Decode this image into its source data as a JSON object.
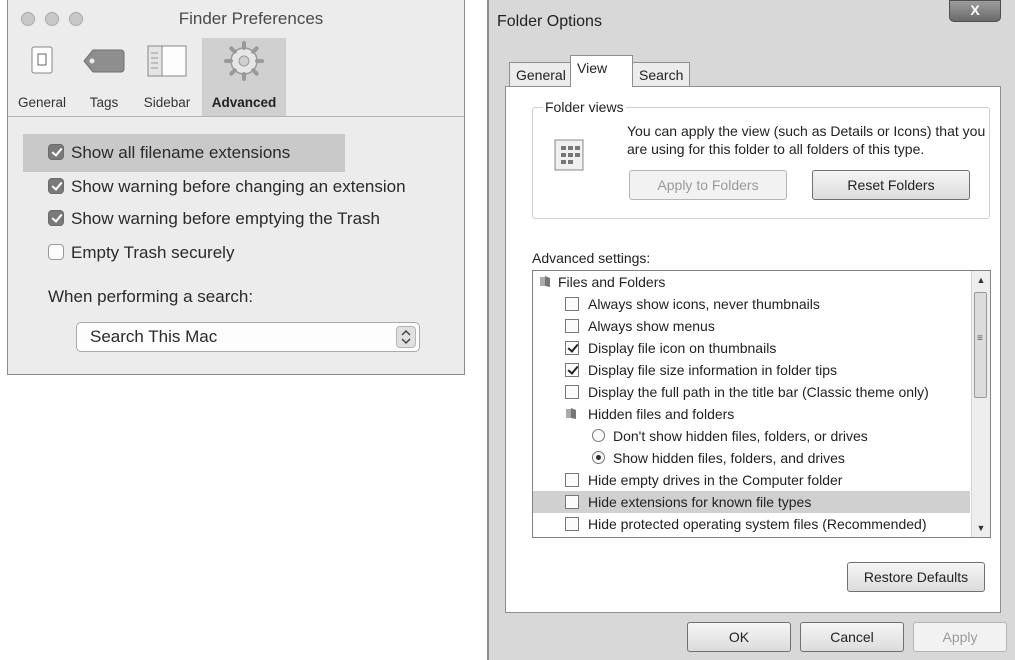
{
  "finder": {
    "title": "Finder Preferences",
    "toolbar": [
      {
        "label": "General",
        "icon": "general-icon"
      },
      {
        "label": "Tags",
        "icon": "tag-icon"
      },
      {
        "label": "Sidebar",
        "icon": "sidebar-icon"
      },
      {
        "label": "Advanced",
        "icon": "gear-icon",
        "active": true
      }
    ],
    "options": [
      {
        "label": "Show all filename extensions",
        "checked": true,
        "highlighted": true
      },
      {
        "label": "Show warning before changing an extension",
        "checked": true
      },
      {
        "label": "Show warning before emptying the Trash",
        "checked": true
      },
      {
        "label": "Empty Trash securely",
        "checked": false
      }
    ],
    "search_label": "When performing a search:",
    "search_value": "Search This Mac"
  },
  "folder_options": {
    "title": "Folder Options",
    "close_label": "X",
    "tabs": [
      {
        "label": "General"
      },
      {
        "label": "View",
        "selected": true
      },
      {
        "label": "Search"
      }
    ],
    "folder_views": {
      "title": "Folder views",
      "description": "You can apply the view (such as Details or Icons) that you are using for this folder to all folders of this type.",
      "apply_label": "Apply to Folders",
      "reset_label": "Reset Folders"
    },
    "advanced_label": "Advanced settings:",
    "items": [
      {
        "label": "Files and Folders",
        "kind": "folder"
      },
      {
        "label": "Always show icons, never thumbnails",
        "kind": "checkbox",
        "checked": false
      },
      {
        "label": "Always show menus",
        "kind": "checkbox",
        "checked": false
      },
      {
        "label": "Display file icon on thumbnails",
        "kind": "checkbox",
        "checked": true
      },
      {
        "label": "Display file size information in folder tips",
        "kind": "checkbox",
        "checked": true
      },
      {
        "label": "Display the full path in the title bar (Classic theme only)",
        "kind": "checkbox",
        "checked": false
      },
      {
        "label": "Hidden files and folders",
        "kind": "folder"
      },
      {
        "label": "Don't show hidden files, folders, or drives",
        "kind": "radio",
        "checked": false
      },
      {
        "label": "Show hidden files, folders, and drives",
        "kind": "radio",
        "checked": true
      },
      {
        "label": "Hide empty drives in the Computer folder",
        "kind": "checkbox",
        "checked": false
      },
      {
        "label": "Hide extensions for known file types",
        "kind": "checkbox",
        "checked": false,
        "highlighted": true
      },
      {
        "label": "Hide protected operating system files (Recommended)",
        "kind": "checkbox",
        "checked": false
      }
    ],
    "restore_label": "Restore Defaults",
    "ok_label": "OK",
    "cancel_label": "Cancel",
    "apply_label": "Apply"
  }
}
